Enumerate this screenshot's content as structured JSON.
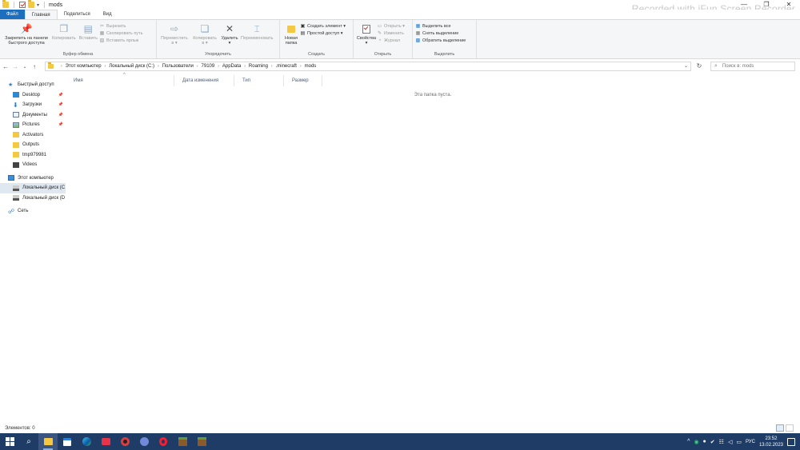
{
  "window": {
    "title": "mods",
    "watermark": "Recorded with iFun Screen Recorder",
    "controls": {
      "minimize": "—",
      "maximize": "❐",
      "close": "✕"
    }
  },
  "quick_access_toolbar": {
    "dropdown": "▾"
  },
  "tabs": [
    {
      "label": "Файл",
      "kind": "file"
    },
    {
      "label": "Главная",
      "kind": "active"
    },
    {
      "label": "Поделиться",
      "kind": "normal"
    },
    {
      "label": "Вид",
      "kind": "normal"
    }
  ],
  "ribbon": {
    "clipboard": {
      "label": "Буфер обмена",
      "pin": "Закрепить на панели быстрого доступа",
      "copy": "Копировать",
      "paste": "Вставить",
      "cut": "Вырезать",
      "copy_path": "Скопировать путь",
      "paste_shortcut": "Вставить ярлык"
    },
    "organize": {
      "label": "Упорядочить",
      "move_to": "Переместить в ▾",
      "copy_to": "Копировать в ▾",
      "delete": "Удалить ▾",
      "rename": "Переименовать"
    },
    "create": {
      "label": "Создать",
      "new_folder": "Новая папка",
      "new_item": "Создать элемент ▾",
      "easy_access": "Простой доступ ▾"
    },
    "open": {
      "label": "Открыть",
      "properties": "Свойства ▾",
      "open": "Открыть ▾",
      "edit": "Изменить",
      "history": "Журнал"
    },
    "select": {
      "label": "Выделить",
      "select_all": "Выделить все",
      "select_none": "Снять выделение",
      "invert": "Обратить выделение"
    }
  },
  "navigation": {
    "back": "←",
    "forward": "→",
    "recent": "⌄",
    "up": "↑",
    "breadcrumb": [
      "Этот компьютер",
      "Локальный диск (C:)",
      "Пользователи",
      "79109",
      "AppData",
      "Roaming",
      ".minecraft",
      "mods"
    ],
    "address_dropdown": "⌄",
    "refresh": "↻",
    "search_placeholder": "Поиск в: mods"
  },
  "nav_pane": {
    "quick_access": "Быстрый доступ",
    "items": [
      {
        "label": "Desktop",
        "icon": "desktop-icon",
        "pinned": true
      },
      {
        "label": "Загрузки",
        "icon": "downloads-icon",
        "pinned": true
      },
      {
        "label": "Документы",
        "icon": "documents-icon",
        "pinned": true
      },
      {
        "label": "Pictures",
        "icon": "pictures-icon",
        "pinned": true
      },
      {
        "label": "Activators",
        "icon": "folder-icon",
        "pinned": false
      },
      {
        "label": "Outputs",
        "icon": "folder-icon",
        "pinned": false
      },
      {
        "label": "tmp979981",
        "icon": "folder-icon",
        "pinned": false
      },
      {
        "label": "Videos",
        "icon": "videos-icon",
        "pinned": false
      }
    ],
    "this_pc": "Этот компьютер",
    "drive_c": "Локальный диск (С",
    "drive_d": "Локальный диск (D",
    "network": "Сеть",
    "pin_glyph": "📌"
  },
  "columns": [
    {
      "label": "Имя"
    },
    {
      "label": "Дата изменения"
    },
    {
      "label": "Тип"
    },
    {
      "label": "Размер"
    }
  ],
  "sort_glyph": "^",
  "empty_message": "Эта папка пуста.",
  "status": {
    "items_count": "Элементов: 0"
  },
  "taskbar": {
    "search": "⌕",
    "tray_up": "^",
    "language": "РУС",
    "time": "23:52",
    "date": "13.02.2023"
  }
}
